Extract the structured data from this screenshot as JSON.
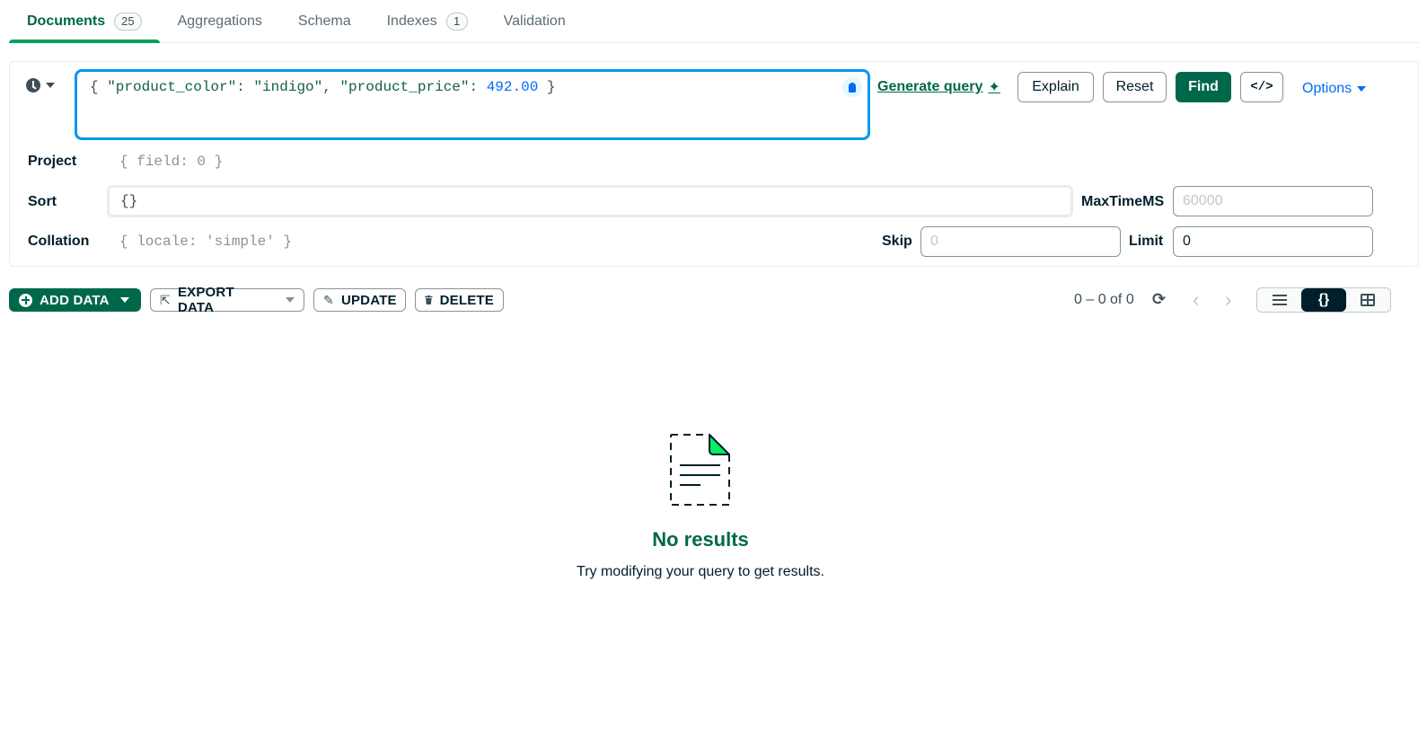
{
  "tabs": [
    {
      "label": "Documents",
      "badge": "25"
    },
    {
      "label": "Aggregations"
    },
    {
      "label": "Schema"
    },
    {
      "label": "Indexes",
      "badge": "1"
    },
    {
      "label": "Validation"
    }
  ],
  "query": {
    "filter": {
      "open": "{ ",
      "key1": "\"product_color\"",
      "sep1": ": ",
      "val1": "\"indigo\"",
      "comma": ", ",
      "key2": "\"product_price\"",
      "sep2": ": ",
      "val2": "492.00",
      "close": " }"
    },
    "generate_query": "Generate query",
    "explain": "Explain",
    "reset": "Reset",
    "find": "Find",
    "code": "</>",
    "options": "Options",
    "project_label": "Project",
    "project_placeholder": "{ field: 0 }",
    "sort_label": "Sort",
    "sort_value": "{}",
    "maxtime_label": "MaxTimeMS",
    "maxtime_placeholder": "60000",
    "collation_label": "Collation",
    "collation_placeholder": "{ locale: 'simple' }",
    "skip_label": "Skip",
    "skip_placeholder": "0",
    "limit_label": "Limit",
    "limit_value": "0"
  },
  "toolbar": {
    "add_data": "ADD DATA",
    "export_data": "EXPORT DATA",
    "update": "UPDATE",
    "delete": "DELETE",
    "pager": "0 – 0 of 0"
  },
  "empty": {
    "title": "No results",
    "subtitle": "Try modifying your query to get results."
  },
  "colors": {
    "brand_green": "#00684a",
    "accent_blue": "#016bf8",
    "focus_blue": "#0498ec"
  }
}
